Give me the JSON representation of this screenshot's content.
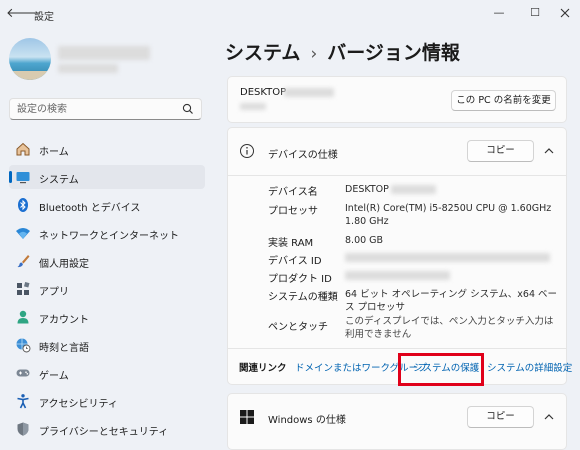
{
  "titlebar": {
    "app_title": "設定",
    "back_glyph": "🡐",
    "minimize_glyph": "—",
    "maximize_glyph": "☐"
  },
  "search": {
    "placeholder": "設定の検索"
  },
  "sidebar": {
    "items": [
      {
        "label": "ホーム",
        "icon": "home-icon"
      },
      {
        "label": "システム",
        "icon": "system-icon",
        "active": true
      },
      {
        "label": "Bluetooth とデバイス",
        "icon": "bluetooth-icon"
      },
      {
        "label": "ネットワークとインターネット",
        "icon": "wifi-icon"
      },
      {
        "label": "個人用設定",
        "icon": "brush-icon"
      },
      {
        "label": "アプリ",
        "icon": "apps-icon"
      },
      {
        "label": "アカウント",
        "icon": "account-icon"
      },
      {
        "label": "時刻と言語",
        "icon": "globe-clock-icon"
      },
      {
        "label": "ゲーム",
        "icon": "gamepad-icon"
      },
      {
        "label": "アクセシビリティ",
        "icon": "accessibility-icon"
      },
      {
        "label": "プライバシーとセキュリティ",
        "icon": "shield-icon"
      }
    ]
  },
  "breadcrumb": {
    "parent": "システム",
    "separator": "›",
    "current": "バージョン情報"
  },
  "device_name_card": {
    "name": "DESKTOP",
    "rename_label": "この PC の名前を変更"
  },
  "device_specs": {
    "title": "デバイスの仕様",
    "copy_label": "コピー",
    "rows": [
      {
        "label": "デバイス名",
        "value": "DESKTOP"
      },
      {
        "label": "プロセッサ",
        "value": "Intel(R) Core(TM) i5-8250U CPU @ 1.60GHz 1.80 GHz"
      },
      {
        "label": "実装 RAM",
        "value": "8.00 GB"
      },
      {
        "label": "デバイス ID",
        "value": ""
      },
      {
        "label": "プロダクト ID",
        "value": ""
      },
      {
        "label": "システムの種類",
        "value": "64 ビット オペレーティング システム、x64 ベース プロセッサ"
      },
      {
        "label": "ペンとタッチ",
        "value": "このディスプレイでは、ペン入力とタッチ入力は利用できません"
      }
    ]
  },
  "related_links": {
    "label": "関連リンク",
    "links": [
      "ドメインまたはワークグループ",
      "システムの保護",
      "システムの詳細設定"
    ]
  },
  "windows_specs": {
    "title": "Windows の仕様",
    "copy_label": "コピー"
  },
  "colors": {
    "accent": "#0067c0",
    "link": "#0063b1",
    "highlight": "#e0001a"
  }
}
